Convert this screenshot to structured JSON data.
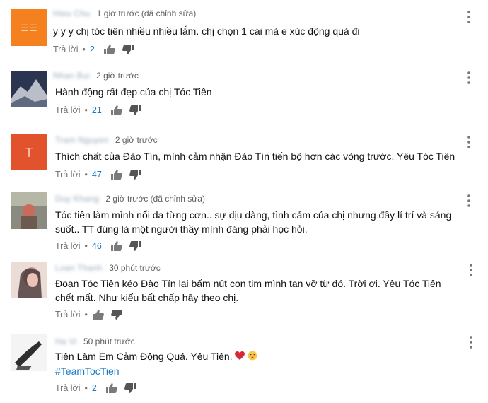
{
  "comments": [
    {
      "author": "Hieu Chu",
      "time": "1 giờ trước (đã chỉnh sửa)",
      "lines": [
        "y y y chị tóc tiên nhiều nhiều lắm. chị chọn 1 cái mà e xúc động quá đi"
      ],
      "reply": "Trả lời",
      "likes": "2",
      "avatar_color": "#f4801f"
    },
    {
      "author": "Nhan Bui",
      "time": "2 giờ trước",
      "lines": [
        "Hành động rất đẹp của chị Tóc Tiên"
      ],
      "reply": "Trả lời",
      "likes": "21",
      "avatar_color": "#2b3550"
    },
    {
      "author": "Tram Nguyen",
      "time": "2 giờ trước",
      "lines": [
        "Thích chất của Đào Tín, mình cảm nhận Đào Tín tiến bộ hơn các vòng trước. Yêu Tóc Tiên"
      ],
      "reply": "Trả lời",
      "likes": "47",
      "avatar_color": "#e2532d"
    },
    {
      "author": "Duy Khang",
      "time": "2 giờ trước (đã chỉnh sửa)",
      "lines": [
        "Tóc tiên làm mình nổi da từng cơn.. sự dịu dàng, tình cảm của chị nhưng đầy lí trí và sáng",
        "suốt.. TT đúng là một người thầy mình đáng phải học hỏi."
      ],
      "reply": "Trả lời",
      "likes": "46",
      "avatar_color": "#8a8a80"
    },
    {
      "author": "Loan Thanh",
      "time": "30 phút trước",
      "lines": [
        "Đoạn Tóc Tiên kéo Đào Tín lại bấm nút con tim mình tan vỡ từ đó. Trời ơi. Yêu Tóc Tiên",
        "chết mất. Như kiểu bất chấp hãy theo chị."
      ],
      "reply": "Trả lời",
      "likes": "",
      "avatar_color": "#d7c0b8"
    },
    {
      "author": "Ha Vi",
      "time": "50 phút trước",
      "lines": [
        "Tiên Làm Em Cảm Động Quá. Yêu Tiên. ",
        "#TeamTocTien"
      ],
      "reply": "Trả lời",
      "likes": "2",
      "avatar_color": "#dcdcdc"
    }
  ],
  "icons": {
    "like": "thumbs-up-icon",
    "dislike": "thumbs-down-icon",
    "more": "more-vert-icon",
    "emoji1": "heart-emoji",
    "emoji2": "kiss-emoji"
  }
}
